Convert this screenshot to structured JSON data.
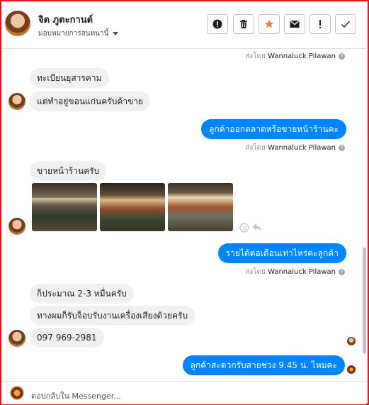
{
  "header": {
    "name": "จิต ภูตะกานต์",
    "subtitle": "มอบหมายการสนทนานี้",
    "toolbar": [
      "report-icon",
      "trash-icon",
      "star-icon",
      "mail-icon",
      "exclamation-icon",
      "check-icon"
    ]
  },
  "messages": {
    "sent_by_prefix": "ส่งโดย",
    "sender": "Wannaluck Pilawan",
    "m1": "ทะเบียนยุสารคาม",
    "m2": "แต่ทำอยู่ขอนแก่นครับค้าขาย",
    "m3": "ลูกค้าออกตลาดหรือขายหน้าร้านคะ",
    "m4": "ขายหน้าร้านครับ",
    "m5": "รายได้ต่อเดือนเท่าไหร่คะลูกค้า",
    "m6": "ก็ประมาณ 2-3 หมื่นครับ",
    "m7": "ทางผมก็รับจ็อบรับงานเครื่องเสียงด้วยครับ",
    "m8": "097 969-2981",
    "m9": "ลูกค้าสะดวกรับสายช่วง 9.45 น. ไหมคะ"
  },
  "composer": {
    "placeholder": "ตอบกลับใน Messenger..."
  },
  "colors": {
    "accent": "#0084ff",
    "frame": "#e8141d",
    "star": "#f5821f"
  }
}
